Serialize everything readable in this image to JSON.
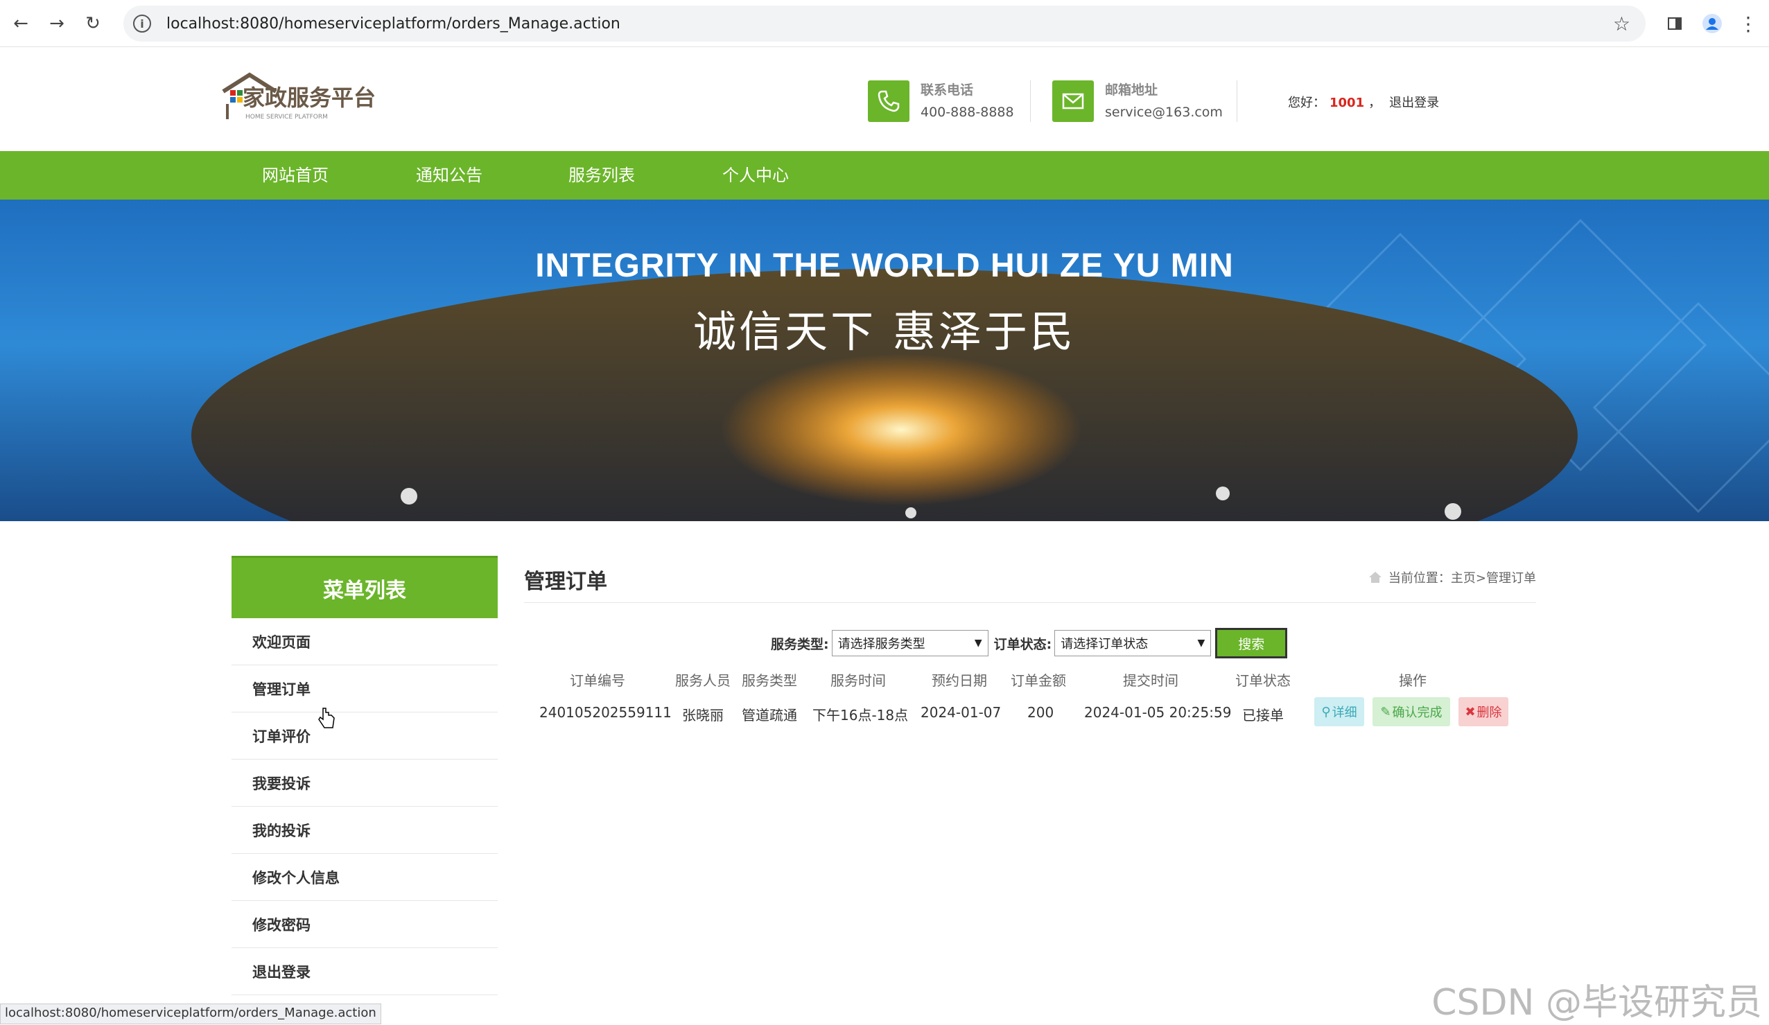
{
  "browser": {
    "url": "localhost:8080/homeserviceplatform/orders_Manage.action",
    "status_url": "localhost:8080/homeserviceplatform/orders_Manage.action"
  },
  "header": {
    "logo_text": "家政服务平台",
    "logo_sub": "HOME SERVICE PLATFORM",
    "phone_title": "联系电话",
    "phone_value": "400-888-8888",
    "email_title": "邮箱地址",
    "email_value": "service@163.com",
    "greeting": "您好：",
    "user_id": "1001",
    "comma": "，",
    "logout": "退出登录"
  },
  "nav": {
    "items": [
      "网站首页",
      "通知公告",
      "服务列表",
      "个人中心"
    ]
  },
  "banner": {
    "english": "INTEGRITY IN THE WORLD HUI ZE YU MIN",
    "chinese": "诚信天下  惠泽于民"
  },
  "sidebar": {
    "title": "菜单列表",
    "items": [
      "欢迎页面",
      "管理订单",
      "订单评价",
      "我要投诉",
      "我的投诉",
      "修改个人信息",
      "修改密码",
      "退出登录"
    ]
  },
  "content": {
    "title": "管理订单",
    "breadcrumb": "当前位置：主页>管理订单",
    "search": {
      "service_type_label": "服务类型:",
      "service_type_value": "请选择服务类型",
      "order_status_label": "订单状态:",
      "order_status_value": "请选择订单状态",
      "search_button": "搜索"
    },
    "table": {
      "headers": [
        "订单编号",
        "服务人员",
        "服务类型",
        "服务时间",
        "预约日期",
        "订单金额",
        "提交时间",
        "订单状态",
        "操作"
      ],
      "rows": [
        {
          "order_no": "240105202559111",
          "staff": "张晓丽",
          "service_type": "管道疏通",
          "service_time": "下午16点-18点",
          "date": "2024-01-07",
          "amount": "200",
          "submit_time": "2024-01-05 20:25:59",
          "status": "已接单",
          "actions": [
            "详细",
            "确认完成",
            "删除"
          ]
        }
      ]
    }
  },
  "watermark": "CSDN @毕设研究员",
  "colors": {
    "accent": "#6bb52a",
    "highlight": "#d9261c"
  }
}
